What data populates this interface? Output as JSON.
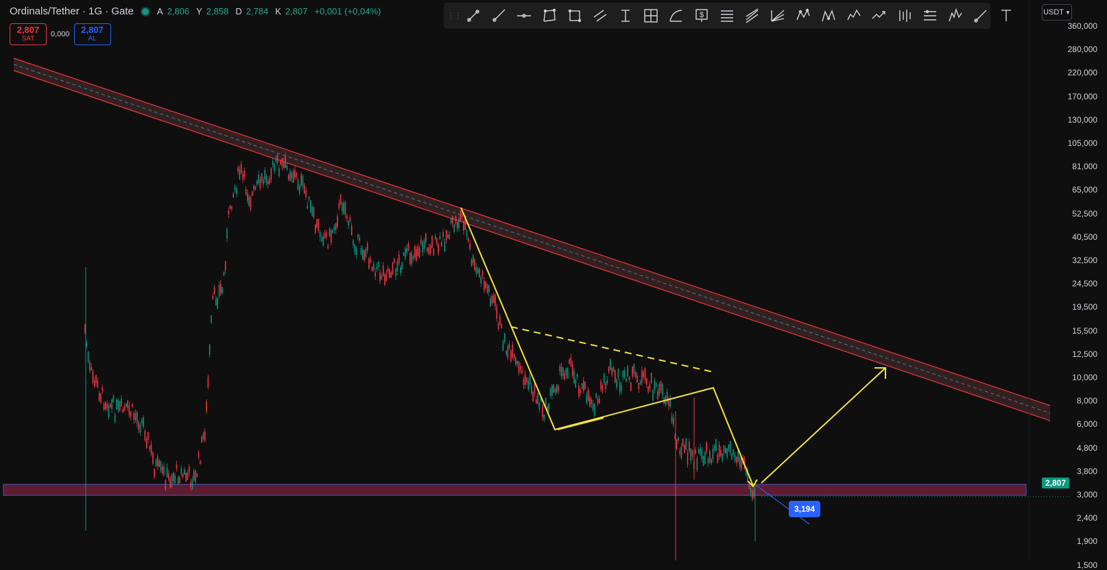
{
  "header": {
    "title": "Ordinals/Tether · 1G · Gate",
    "ohlc": [
      {
        "k": "A",
        "v": "2,806"
      },
      {
        "k": "Y",
        "v": "2,858"
      },
      {
        "k": "D",
        "v": "2,784"
      },
      {
        "k": "K",
        "v": "2,807"
      }
    ],
    "change": "+0,001 (+0,04%)"
  },
  "trade": {
    "sell_price": "2,807",
    "sell_label": "SAT",
    "spread": "0,000",
    "buy_price": "2,807",
    "buy_label": "AL"
  },
  "currency": "USDT",
  "axis_ticks": [
    "360,000",
    "280,000",
    "220,000",
    "170,000",
    "130,000",
    "105,000",
    "81,000",
    "65,000",
    "52,500",
    "40,500",
    "32,500",
    "24,500",
    "19,500",
    "15,500",
    "12,500",
    "10,000",
    "8,000",
    "6,000",
    "4,800",
    "3,800",
    "3,000",
    "2,400",
    "1,900",
    "1,500"
  ],
  "last_price": "2,807",
  "callout_label": "3,194",
  "toolbar_icons": [
    "trend-line-icon",
    "ray-icon",
    "horizontal-line-icon",
    "polyline-icon",
    "rectangle-icon",
    "parallel-channel-icon",
    "long-position-icon",
    "cross-grid-icon",
    "arc-icon",
    "price-label-icon",
    "fib-retracement-icon",
    "pitchfork-icon",
    "gann-fan-icon",
    "pattern-icon",
    "xabcd-pattern-icon",
    "elliott-wave-icon",
    "path-icon",
    "bars-pattern-icon",
    "ruler-icon",
    "head-shoulders-icon",
    "brush-icon",
    "text-icon"
  ],
  "colors": {
    "background": "#0f0f0f",
    "up": "#089981",
    "down": "#f23645",
    "drawing": "#f7e43a",
    "channel": "#f23645",
    "zone": "#2962ff"
  }
}
